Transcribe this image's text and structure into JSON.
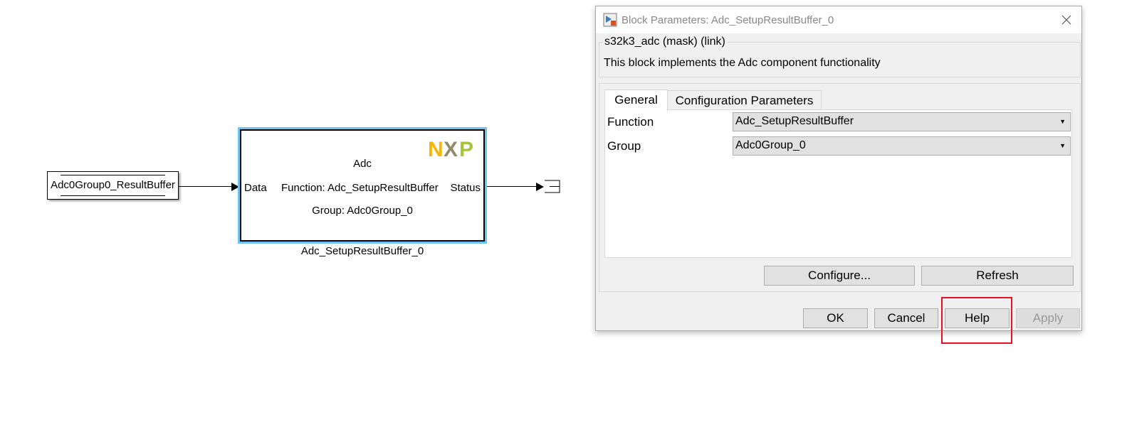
{
  "diagram": {
    "from_block": {
      "label": "Adc0Group0_ResultBuffer"
    },
    "adc_block": {
      "title": "Adc",
      "input_port": "Data",
      "output_port": "Status",
      "function_text": "Function: Adc_SetupResultBuffer",
      "group_text": "Group: Adc0Group_0",
      "logo": "NXP",
      "name": "Adc_SetupResultBuffer_0"
    }
  },
  "dialog": {
    "title": "Block Parameters: Adc_SetupResultBuffer_0",
    "mask_group": "s32k3_adc (mask) (link)",
    "description": "This block implements the Adc component functionality",
    "tabs": [
      {
        "label": "General",
        "selected": true
      },
      {
        "label": "Configuration Parameters",
        "selected": false
      }
    ],
    "params": [
      {
        "label": "Function",
        "value": "Adc_SetupResultBuffer"
      },
      {
        "label": "Group",
        "value": "Adc0Group_0"
      }
    ],
    "configure_label": "Configure...",
    "refresh_label": "Refresh",
    "ok_label": "OK",
    "cancel_label": "Cancel",
    "help_label": "Help",
    "apply_label": "Apply",
    "highlight_color": "#e81123"
  }
}
